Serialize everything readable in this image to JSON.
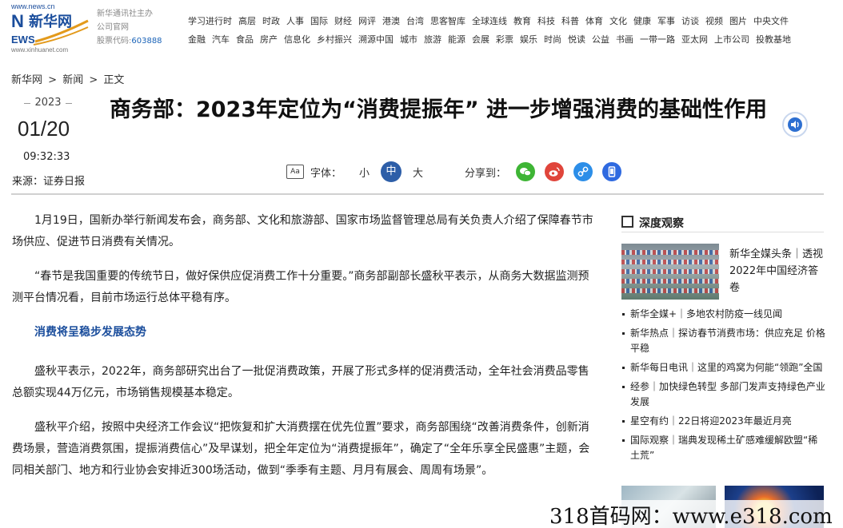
{
  "site": {
    "logo_url_text": "www.news.cn",
    "logo_text": "新华网",
    "logo_sub": "www.xinhuanet.com",
    "info_lines": [
      "新华通讯社主办",
      "公司官网"
    ],
    "stock_label": "股票代码:",
    "stock_code": "603888"
  },
  "nav": {
    "row1": [
      "学习进行时",
      "高层",
      "时政",
      "人事",
      "国际",
      "财经",
      "网评",
      "港澳",
      "台湾",
      "思客智库",
      "全球连线",
      "教育",
      "科技",
      "科普",
      "体育",
      "文化",
      "健康",
      "军事",
      "访谈",
      "视频",
      "图片",
      "中央文件"
    ],
    "row2": [
      "金融",
      "汽车",
      "食品",
      "房产",
      "信息化",
      "乡村振兴",
      "溯源中国",
      "城市",
      "旅游",
      "能源",
      "会展",
      "彩票",
      "娱乐",
      "时尚",
      "悦读",
      "公益",
      "书画",
      "一带一路",
      "亚太网",
      "上市公司",
      "投教基地"
    ]
  },
  "breadcrumb": [
    "新华网",
    ">",
    "新闻",
    ">",
    "正文"
  ],
  "meta": {
    "year": "2023",
    "month_day": "01/20",
    "time": "09:32:33",
    "source": "来源：证券日报"
  },
  "title": "商务部：2023年定位为“消费提振年” 进一步增强消费的基础性作用",
  "toolbar": {
    "font_label": "字体：",
    "small": "小",
    "medium": "中",
    "large": "大",
    "share_label": "分享到："
  },
  "article": {
    "p1": "1月19日，国新办举行新闻发布会，商务部、文化和旅游部、国家市场监督管理总局有关负责人介绍了保障春节市场供应、促进节日消费有关情况。",
    "p2": "“春节是我国重要的传统节日，做好保供应促消费工作十分重要。”商务部副部长盛秋平表示，从商务大数据监测预测平台情况看，目前市场运行总体平稳有序。",
    "subhead": "消费将呈稳步发展态势",
    "p3": "盛秋平表示，2022年，商务部研究出台了一批促消费政策，开展了形式多样的促消费活动，全年社会消费品零售总额实现44万亿元，市场销售规模基本稳定。",
    "p4": "盛秋平介绍，按照中央经济工作会议“把恢复和扩大消费摆在优先位置”要求，商务部围绕“改善消费条件，创新消费场景，营造消费氛围，提振消费信心”及早谋划，把全年定位为“消费提振年”，确定了“全年乐享全民盛惠”主题，会同相关部门、地方和行业协会安排近300场活动，做到“季季有主题、月月有展会、周周有场景”。"
  },
  "sidebar": {
    "title": "深度观察",
    "feature": "新华全媒头条｜透视2022年中国经济答卷",
    "items": [
      "新华全媒+｜多地农村防疫一线见闻",
      "新华热点｜探访春节消费市场：供应充足 价格平稳",
      "新华每日电讯｜这里的鸡窝为何能“领跑”全国",
      "经参｜加快绿色转型 多部门发声支持绿色产业发展",
      "星空有约｜22日将迎2023年最近月亮",
      "国际观察｜瑞典发现稀土矿感难缓解欧盟“稀土荒”"
    ]
  },
  "watermark": "318首码网：www.e318.com",
  "colors": {
    "brand_blue": "#1a4d9c",
    "active_font": "#2d5ea8",
    "wechat": "#3eb535",
    "weibo": "#e0453b",
    "link_share": "#2c8ee8",
    "mobile_share": "#2f6ae0"
  }
}
